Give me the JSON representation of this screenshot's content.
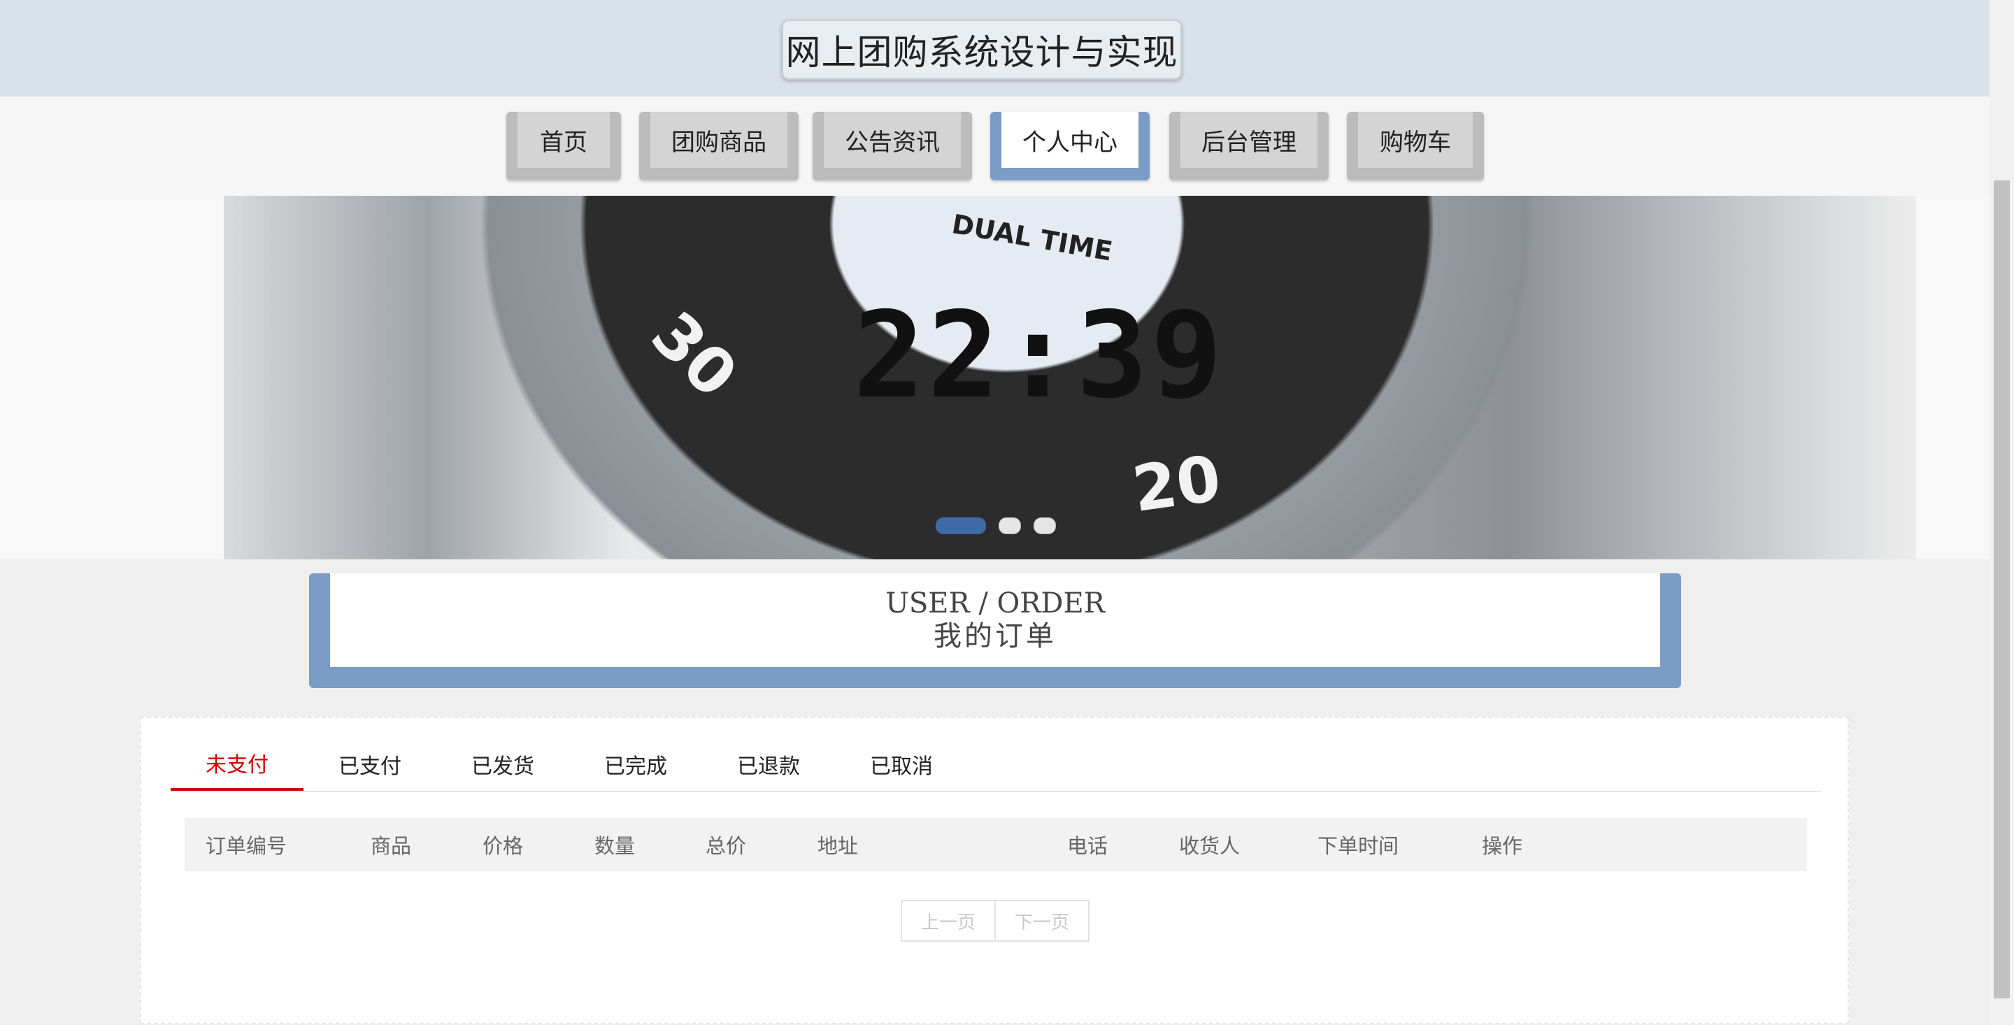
{
  "header": {
    "title": "网上团购系统设计与实现"
  },
  "nav": {
    "items": [
      {
        "label": "首页"
      },
      {
        "label": "团购商品"
      },
      {
        "label": "公告资讯"
      },
      {
        "label": "个人中心"
      },
      {
        "label": "后台管理"
      },
      {
        "label": "购物车"
      }
    ],
    "active_index": 3
  },
  "banner": {
    "slide_count": 3,
    "active_slide": 1
  },
  "section": {
    "title_en": "USER / ORDER",
    "title_cn": "我的订单"
  },
  "tabs": {
    "items": [
      {
        "label": "未支付"
      },
      {
        "label": "已支付"
      },
      {
        "label": "已发货"
      },
      {
        "label": "已完成"
      },
      {
        "label": "已退款"
      },
      {
        "label": "已取消"
      }
    ],
    "active_index": 0
  },
  "table": {
    "columns": [
      "订单编号",
      "商品",
      "价格",
      "数量",
      "总价",
      "地址",
      "电话",
      "收货人",
      "下单时间",
      "操作"
    ],
    "rows": []
  },
  "pager": {
    "prev": "上一页",
    "next": "下一页"
  },
  "colors": {
    "accent_blue": "#7b9cc6",
    "active_tab": "#d10000",
    "header_bg": "#d9e1ea"
  }
}
